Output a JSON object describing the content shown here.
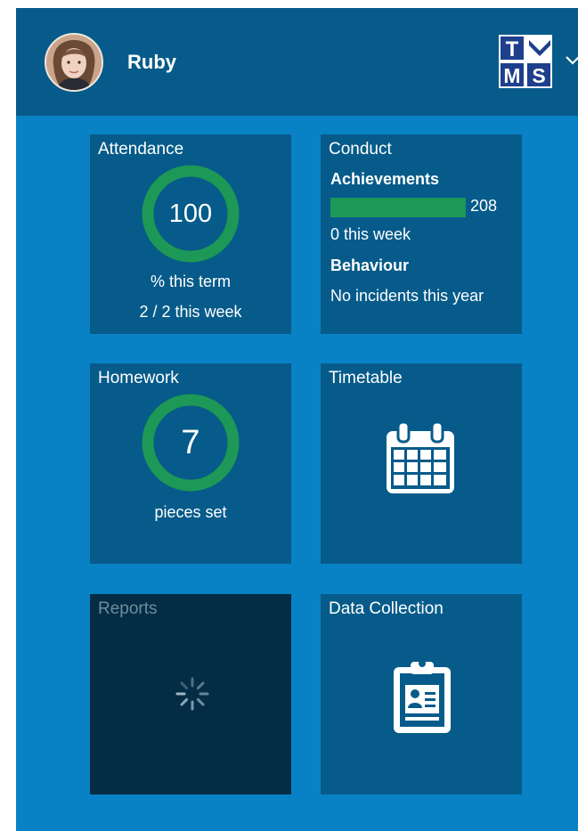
{
  "header": {
    "user_name": "Ruby",
    "avatar_icon": "user-avatar",
    "logo_text": [
      "T",
      "M",
      "S"
    ],
    "menu_icon": "chevron-down-icon"
  },
  "colors": {
    "header_bg": "#065b8a",
    "page_bg": "#0882c4",
    "tile_bg": "#065b8a",
    "tile_loading_bg": "#042d45",
    "ring_green": "#1e9856",
    "bar_green": "#1e9856"
  },
  "tiles": {
    "attendance": {
      "title": "Attendance",
      "value": "100",
      "percent": 100,
      "line1": "% this term",
      "line2": "2 / 2 this week"
    },
    "conduct": {
      "title": "Conduct",
      "achievements_label": "Achievements",
      "achievements_value": "208",
      "achievements_bar_fraction": 1.0,
      "achievements_week": "0 this week",
      "behaviour_label": "Behaviour",
      "behaviour_text": "No incidents this year"
    },
    "homework": {
      "title": "Homework",
      "value": "7",
      "percent": 100,
      "line1": "pieces set"
    },
    "timetable": {
      "title": "Timetable",
      "icon": "calendar-icon"
    },
    "reports": {
      "title": "Reports",
      "icon": "loading-spinner-icon"
    },
    "data_collection": {
      "title": "Data Collection",
      "icon": "clipboard-profile-icon"
    }
  }
}
